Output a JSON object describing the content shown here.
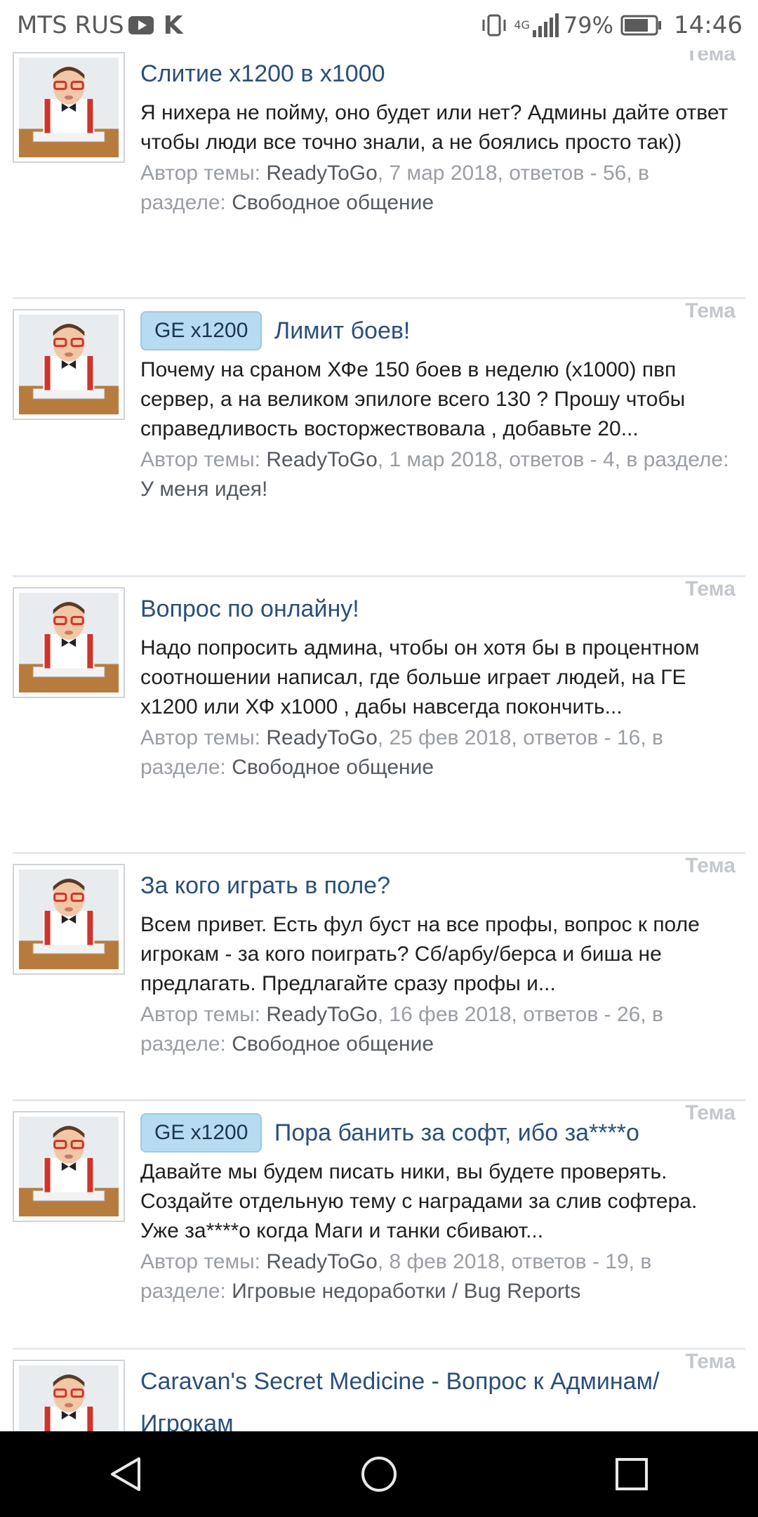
{
  "status_bar": {
    "carrier": "MTS RUS",
    "vk_label": "K",
    "network": "4G",
    "battery_percent": "79%",
    "battery_level": 0.79,
    "time": "14:46"
  },
  "posts": [
    {
      "prefix": "",
      "title": "Слитие х1200 в х1000",
      "type_label": "Тема",
      "snippet": "Я нихера не пойму, оно будет или нет? Админы дайте ответ чтобы люди все точно знали, а не боялись просто так))",
      "author_label": "Автор темы:",
      "author": "ReadyToGo",
      "date_replies": ", 7 мар 2018, ответов - 56, в",
      "section_label": "разделе:",
      "forum": "Свободное общение"
    },
    {
      "prefix": "GE x1200",
      "title": "Лимит боев!",
      "type_label": "Тема",
      "snippet": "Почему на сраном ХФе 150 боев в неделю (х1000) пвп сервер, а на великом эпилоге всего 130 ? Прошу чтобы справедливость восторжествовала , добавьте 20...",
      "author_label": "Автор темы:",
      "author": "ReadyToGo",
      "date_replies": ", 1 мар 2018, ответов - 4, в",
      "section_label": "разделе:",
      "forum": "У меня идея!"
    },
    {
      "prefix": "",
      "title": "Вопрос по онлайну!",
      "type_label": "Тема",
      "snippet": "Надо попросить админа, чтобы он хотя бы в процентном соотношении написал, где больше играет людей, на ГЕ х1200 или ХФ х1000 , дабы навсегда покончить...",
      "author_label": "Автор темы:",
      "author": "ReadyToGo",
      "date_replies": ", 25 фев 2018, ответов - 16, в",
      "section_label": "разделе:",
      "forum": "Свободное общение"
    },
    {
      "prefix": "",
      "title": "За кого играть в поле?",
      "type_label": "Тема",
      "snippet": "Всем привет. Есть фул буст на все профы, вопрос к поле игрокам - за кого поиграть? Сб/арбу/берса и биша не предлагать. Предлагайте сразу профы и...",
      "author_label": "Автор темы:",
      "author": "ReadyToGo",
      "date_replies": ", 16 фев 2018, ответов - 26, в",
      "section_label": "разделе:",
      "forum": "Свободное общение"
    },
    {
      "prefix": "GE x1200",
      "title": "Пора банить за софт, ибо за****о",
      "type_label": "Тема",
      "snippet": "Давайте мы будем писать ники, вы будете проверять. Создайте отдельную тему с наградами за слив софтера. Уже за****о когда Маги и танки сбивают...",
      "author_label": "Автор темы:",
      "author": "ReadyToGo",
      "date_replies": ", 8 фев 2018, ответов - 19, в",
      "section_label": "разделе:",
      "forum": "Игровые недоработки / Bug Reports"
    },
    {
      "prefix": "",
      "title": "Caravan's Secret Medicine - Вопрос к Админам/Игрокам",
      "type_label": "Тема",
      "snippet": "",
      "author_label": "",
      "author": "",
      "date_replies": "",
      "section_label": "",
      "forum": ""
    }
  ],
  "nav": {
    "back_icon": "back-triangle-icon",
    "home_icon": "home-circle-icon",
    "recents_icon": "recents-square-icon"
  }
}
